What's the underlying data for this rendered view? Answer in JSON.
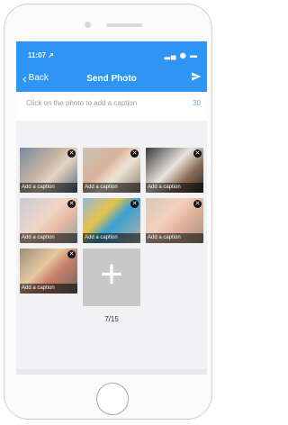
{
  "status": {
    "time": "11:07 ↗",
    "icons": "▂▄ ◉ ▬"
  },
  "nav": {
    "back_label": "Back",
    "title": "Send Photo",
    "send_icon": "send-icon"
  },
  "caption": {
    "placeholder": "Click on the photo to add a caption",
    "count": "30"
  },
  "photos": [
    {
      "caption": "Add a caption"
    },
    {
      "caption": "Add a caption"
    },
    {
      "caption": "Add a caption"
    },
    {
      "caption": "Add a caption"
    },
    {
      "caption": "Add a caption"
    },
    {
      "caption": "Add a caption"
    },
    {
      "caption": "Add a caption"
    }
  ],
  "counter": "7/15",
  "colors": {
    "accent": "#2f95f5"
  }
}
